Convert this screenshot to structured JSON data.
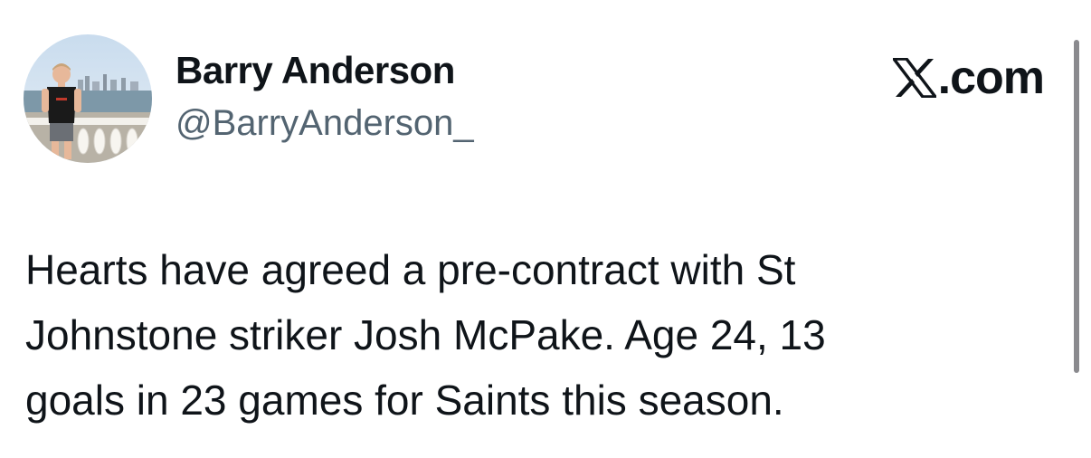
{
  "author": {
    "name": "Barry Anderson",
    "handle": "@BarryAnderson_"
  },
  "brand": {
    "logo_icon": "x-logo-icon",
    "text": ".com"
  },
  "tweet": {
    "lines": [
      "Hearts have agreed a pre-contract with St",
      "Johnstone striker Josh McPake. Age 24, 13",
      "goals in 23 games for Saints this season."
    ]
  },
  "colors": {
    "text": "#0f1419",
    "handle": "#536471",
    "background": "#ffffff",
    "scrollbar": "#8a8a8e"
  }
}
